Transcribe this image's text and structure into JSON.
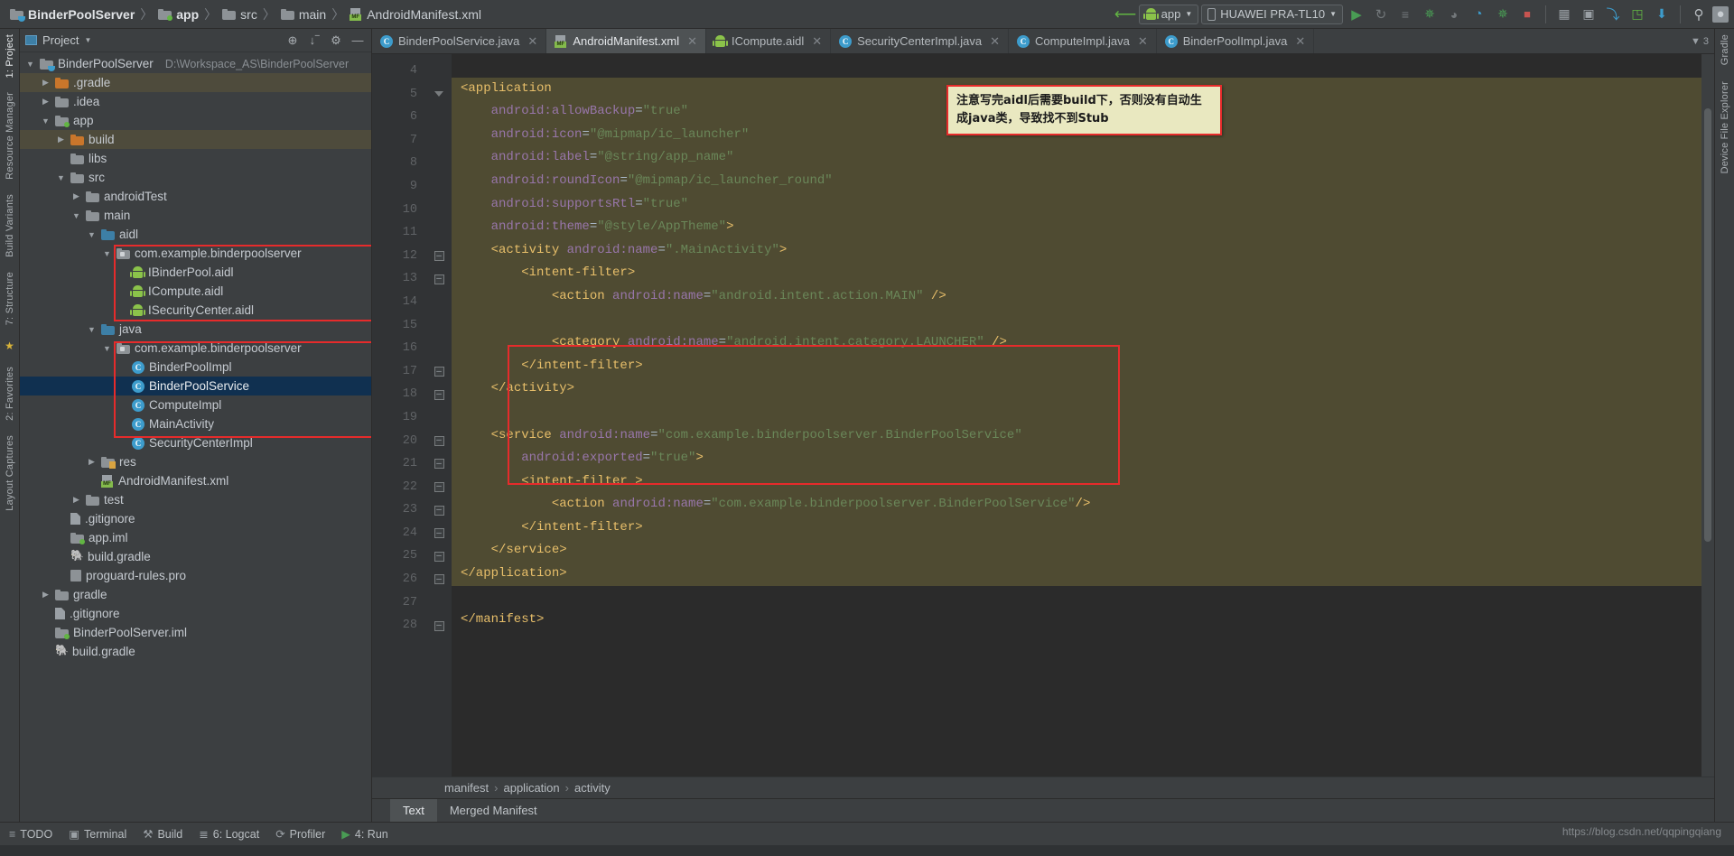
{
  "breadcrumb": {
    "items": [
      {
        "label": "BinderPoolServer",
        "icon": "project-folder-icon",
        "bold": true
      },
      {
        "label": "app",
        "icon": "module-folder-icon",
        "bold": true
      },
      {
        "label": "src",
        "icon": "folder-icon",
        "bold": false
      },
      {
        "label": "main",
        "icon": "folder-icon",
        "bold": false
      },
      {
        "label": "AndroidManifest.xml",
        "icon": "manifest-icon",
        "bold": false
      }
    ],
    "separator": "〉"
  },
  "toolbar": {
    "back_arrow": "↖",
    "run_config": "app",
    "device": "HUAWEI PRA-TL10",
    "dropdown_caret": "▼",
    "icons": [
      {
        "name": "run-icon",
        "glyph": "▶",
        "color": "#499c54"
      },
      {
        "name": "apply-changes-icon",
        "glyph": "↻",
        "color": "#6e7376"
      },
      {
        "name": "rerun-icon",
        "glyph": "≡",
        "color": "#6e7376"
      },
      {
        "name": "debug-icon",
        "glyph": "✵",
        "color": "#499c54"
      },
      {
        "name": "attach-debugger-icon",
        "glyph": "◗",
        "color": "#6e7376"
      },
      {
        "name": "profiler-icon",
        "glyph": "◔",
        "color": "#3d9ccc"
      },
      {
        "name": "run-with-coverage-icon",
        "glyph": "↗",
        "color": "#499c54"
      },
      {
        "name": "stop-icon",
        "glyph": "■",
        "color": "#c75450"
      },
      {
        "name": "sdk-manager-icon",
        "glyph": "▧",
        "color": "#9aa0a5"
      },
      {
        "name": "avd-manager-icon",
        "glyph": "▣",
        "color": "#9aa0a5"
      },
      {
        "name": "sync-gradle-icon",
        "glyph": "⤵",
        "color": "#3d9ccc"
      },
      {
        "name": "layout-inspector-icon",
        "glyph": "◳",
        "color": "#62b543"
      },
      {
        "name": "device-file-explorer-icon",
        "glyph": "⬇",
        "color": "#3d9ccc"
      },
      {
        "name": "search-everywhere-icon",
        "glyph": "⚲",
        "color": "#b8bdc1"
      },
      {
        "name": "user-avatar-icon",
        "glyph": "●",
        "color": "#c8cdd2"
      }
    ]
  },
  "left_strip": {
    "tabs": [
      {
        "label": "1: Project",
        "active": true
      },
      {
        "label": "Resource Manager",
        "active": false
      },
      {
        "label": "Build Variants",
        "active": false
      },
      {
        "label": "7: Structure",
        "active": false
      },
      {
        "label": "2: Favorites",
        "active": false
      },
      {
        "label": "Layout Captures",
        "active": false
      }
    ],
    "star_icon": "★"
  },
  "right_strip": {
    "tabs": [
      {
        "label": "Gradle"
      },
      {
        "label": "Device File Explorer"
      }
    ]
  },
  "project_panel": {
    "title": "Project",
    "caret": "▼",
    "header_icons": [
      {
        "name": "locate-icon",
        "glyph": "⊕"
      },
      {
        "name": "collapse-all-icon",
        "glyph": "⤓"
      },
      {
        "name": "settings-gear-icon",
        "glyph": "⚙"
      },
      {
        "name": "hide-icon",
        "glyph": "—"
      }
    ],
    "tree": [
      {
        "label": "BinderPoolServer",
        "sub": "D:\\Workspace_AS\\BinderPoolServer",
        "indent": 0,
        "twisty": "down",
        "icon": "project-folder-icon",
        "state": "normal"
      },
      {
        "label": ".gradle",
        "indent": 1,
        "twisty": "right",
        "icon": "folder-orange-icon",
        "state": "highlight"
      },
      {
        "label": ".idea",
        "indent": 1,
        "twisty": "right",
        "icon": "folder-icon",
        "state": "normal"
      },
      {
        "label": "app",
        "indent": 1,
        "twisty": "down",
        "icon": "module-folder-icon",
        "state": "normal"
      },
      {
        "label": "build",
        "indent": 2,
        "twisty": "right",
        "icon": "folder-orange-icon",
        "state": "highlight"
      },
      {
        "label": "libs",
        "indent": 2,
        "twisty": "none",
        "icon": "folder-icon",
        "state": "normal"
      },
      {
        "label": "src",
        "indent": 2,
        "twisty": "down",
        "icon": "folder-icon",
        "state": "normal"
      },
      {
        "label": "androidTest",
        "indent": 3,
        "twisty": "right",
        "icon": "folder-icon",
        "state": "normal"
      },
      {
        "label": "main",
        "indent": 3,
        "twisty": "down",
        "icon": "folder-icon",
        "state": "normal"
      },
      {
        "label": "aidl",
        "indent": 4,
        "twisty": "down",
        "icon": "folder-blue-icon",
        "state": "normal"
      },
      {
        "label": "com.example.binderpoolserver",
        "indent": 5,
        "twisty": "down",
        "icon": "package-icon",
        "state": "normal"
      },
      {
        "label": "IBinderPool.aidl",
        "indent": 6,
        "twisty": "none",
        "icon": "aidl-icon",
        "state": "normal"
      },
      {
        "label": "ICompute.aidl",
        "indent": 6,
        "twisty": "none",
        "icon": "aidl-icon",
        "state": "normal"
      },
      {
        "label": "ISecurityCenter.aidl",
        "indent": 6,
        "twisty": "none",
        "icon": "aidl-icon",
        "state": "normal"
      },
      {
        "label": "java",
        "indent": 4,
        "twisty": "down",
        "icon": "folder-blue-icon",
        "state": "normal"
      },
      {
        "label": "com.example.binderpoolserver",
        "indent": 5,
        "twisty": "down",
        "icon": "package-icon",
        "state": "normal"
      },
      {
        "label": "BinderPoolImpl",
        "indent": 6,
        "twisty": "none",
        "icon": "java-class-icon",
        "state": "normal"
      },
      {
        "label": "BinderPoolService",
        "indent": 6,
        "twisty": "none",
        "icon": "java-class-icon",
        "state": "selected"
      },
      {
        "label": "ComputeImpl",
        "indent": 6,
        "twisty": "none",
        "icon": "java-class-icon",
        "state": "normal"
      },
      {
        "label": "MainActivity",
        "indent": 6,
        "twisty": "none",
        "icon": "java-class-icon",
        "state": "normal"
      },
      {
        "label": "SecurityCenterImpl",
        "indent": 6,
        "twisty": "none",
        "icon": "java-class-icon",
        "state": "normal"
      },
      {
        "label": "res",
        "indent": 4,
        "twisty": "right",
        "icon": "res-folder-icon",
        "state": "normal"
      },
      {
        "label": "AndroidManifest.xml",
        "indent": 4,
        "twisty": "none",
        "icon": "manifest-icon",
        "state": "normal"
      },
      {
        "label": "test",
        "indent": 3,
        "twisty": "right",
        "icon": "folder-icon",
        "state": "normal"
      },
      {
        "label": ".gitignore",
        "indent": 2,
        "twisty": "none",
        "icon": "file-icon",
        "state": "normal"
      },
      {
        "label": "app.iml",
        "indent": 2,
        "twisty": "none",
        "icon": "module-folder-icon",
        "state": "normal"
      },
      {
        "label": "build.gradle",
        "indent": 2,
        "twisty": "none",
        "icon": "gradle-icon",
        "state": "normal"
      },
      {
        "label": "proguard-rules.pro",
        "indent": 2,
        "twisty": "none",
        "icon": "pro-file-icon",
        "state": "normal"
      },
      {
        "label": "gradle",
        "indent": 1,
        "twisty": "right",
        "icon": "folder-icon",
        "state": "normal"
      },
      {
        "label": ".gitignore",
        "indent": 1,
        "twisty": "none",
        "icon": "file-icon",
        "state": "normal"
      },
      {
        "label": "BinderPoolServer.iml",
        "indent": 1,
        "twisty": "none",
        "icon": "module-folder-icon",
        "state": "normal"
      },
      {
        "label": "build.gradle",
        "indent": 1,
        "twisty": "none",
        "icon": "gradle-icon",
        "state": "normal"
      }
    ]
  },
  "editor": {
    "tabs": [
      {
        "label": "BinderPoolService.java",
        "icon": "java-class-icon",
        "active": false,
        "close": "✕"
      },
      {
        "label": "AndroidManifest.xml",
        "icon": "manifest-icon",
        "active": true,
        "close": "✕"
      },
      {
        "label": "ICompute.aidl",
        "icon": "aidl-icon",
        "active": false,
        "close": "✕"
      },
      {
        "label": "SecurityCenterImpl.java",
        "icon": "java-class-icon",
        "active": false,
        "close": "✕"
      },
      {
        "label": "ComputeImpl.java",
        "icon": "java-class-icon",
        "active": false,
        "close": "✕"
      },
      {
        "label": "BinderPoolImpl.java",
        "icon": "java-class-icon",
        "active": false,
        "close": "✕"
      }
    ],
    "tabs_overflow": "▼ 3",
    "line_numbers": [
      4,
      5,
      6,
      7,
      8,
      9,
      10,
      11,
      12,
      13,
      14,
      15,
      16,
      17,
      18,
      19,
      20,
      21,
      22,
      23,
      24,
      25,
      26,
      27,
      28
    ],
    "code_lines": [
      {
        "n": 4,
        "segments": [],
        "shade": false
      },
      {
        "n": 5,
        "segments": [
          {
            "t": "<application",
            "c": "tag"
          }
        ],
        "shade": true
      },
      {
        "n": 6,
        "segments": [
          {
            "t": "    ",
            "c": "plain"
          },
          {
            "t": "android:allowBackup",
            "c": "attr"
          },
          {
            "t": "=",
            "c": "plain"
          },
          {
            "t": "\"true\"",
            "c": "val"
          }
        ],
        "shade": true
      },
      {
        "n": 7,
        "segments": [
          {
            "t": "    ",
            "c": "plain"
          },
          {
            "t": "android:icon",
            "c": "attr"
          },
          {
            "t": "=",
            "c": "plain"
          },
          {
            "t": "\"@mipmap/ic_launcher\"",
            "c": "val"
          }
        ],
        "shade": true
      },
      {
        "n": 8,
        "segments": [
          {
            "t": "    ",
            "c": "plain"
          },
          {
            "t": "android:label",
            "c": "attr"
          },
          {
            "t": "=",
            "c": "plain"
          },
          {
            "t": "\"@string/app_name\"",
            "c": "val"
          }
        ],
        "shade": true
      },
      {
        "n": 9,
        "segments": [
          {
            "t": "    ",
            "c": "plain"
          },
          {
            "t": "android:roundIcon",
            "c": "attr"
          },
          {
            "t": "=",
            "c": "plain"
          },
          {
            "t": "\"@mipmap/ic_launcher_round\"",
            "c": "val"
          }
        ],
        "shade": true
      },
      {
        "n": 10,
        "segments": [
          {
            "t": "    ",
            "c": "plain"
          },
          {
            "t": "android:supportsRtl",
            "c": "attr"
          },
          {
            "t": "=",
            "c": "plain"
          },
          {
            "t": "\"true\"",
            "c": "val"
          }
        ],
        "shade": true
      },
      {
        "n": 11,
        "segments": [
          {
            "t": "    ",
            "c": "plain"
          },
          {
            "t": "android:theme",
            "c": "attr"
          },
          {
            "t": "=",
            "c": "plain"
          },
          {
            "t": "\"@style/AppTheme\"",
            "c": "val"
          },
          {
            "t": ">",
            "c": "tag"
          }
        ],
        "shade": true
      },
      {
        "n": 12,
        "segments": [
          {
            "t": "    ",
            "c": "plain"
          },
          {
            "t": "<activity ",
            "c": "tag"
          },
          {
            "t": "android:name",
            "c": "attr"
          },
          {
            "t": "=",
            "c": "plain"
          },
          {
            "t": "\".MainActivity\"",
            "c": "val"
          },
          {
            "t": ">",
            "c": "tag"
          }
        ],
        "shade": true
      },
      {
        "n": 13,
        "segments": [
          {
            "t": "        ",
            "c": "plain"
          },
          {
            "t": "<intent-filter>",
            "c": "tag"
          }
        ],
        "shade": true
      },
      {
        "n": 14,
        "segments": [
          {
            "t": "            ",
            "c": "plain"
          },
          {
            "t": "<action ",
            "c": "tag"
          },
          {
            "t": "android:name",
            "c": "attr"
          },
          {
            "t": "=",
            "c": "plain"
          },
          {
            "t": "\"android.intent.action.MAIN\"",
            "c": "val"
          },
          {
            "t": " />",
            "c": "tag"
          }
        ],
        "shade": true
      },
      {
        "n": 15,
        "segments": [],
        "shade": true
      },
      {
        "n": 16,
        "segments": [
          {
            "t": "            ",
            "c": "plain"
          },
          {
            "t": "<category ",
            "c": "tag"
          },
          {
            "t": "android:name",
            "c": "attr"
          },
          {
            "t": "=",
            "c": "plain"
          },
          {
            "t": "\"android.intent.category.LAUNCHER\"",
            "c": "val"
          },
          {
            "t": " />",
            "c": "tag"
          }
        ],
        "shade": true
      },
      {
        "n": 17,
        "segments": [
          {
            "t": "        ",
            "c": "plain"
          },
          {
            "t": "</intent-filter>",
            "c": "tag"
          }
        ],
        "shade": true
      },
      {
        "n": 18,
        "segments": [
          {
            "t": "    ",
            "c": "plain"
          },
          {
            "t": "</activity>",
            "c": "tag"
          }
        ],
        "shade": true
      },
      {
        "n": 19,
        "segments": [],
        "shade": true
      },
      {
        "n": 20,
        "segments": [
          {
            "t": "    ",
            "c": "plain"
          },
          {
            "t": "<service ",
            "c": "tag"
          },
          {
            "t": "android:name",
            "c": "attr"
          },
          {
            "t": "=",
            "c": "plain"
          },
          {
            "t": "\"com.example.binderpoolserver.BinderPoolService\"",
            "c": "val"
          }
        ],
        "shade": true
      },
      {
        "n": 21,
        "segments": [
          {
            "t": "        ",
            "c": "plain"
          },
          {
            "t": "android:exported",
            "c": "attr"
          },
          {
            "t": "=",
            "c": "plain"
          },
          {
            "t": "\"true\"",
            "c": "val"
          },
          {
            "t": ">",
            "c": "tag"
          }
        ],
        "shade": true
      },
      {
        "n": 22,
        "segments": [
          {
            "t": "        ",
            "c": "plain"
          },
          {
            "t": "<intent-filter >",
            "c": "tag"
          }
        ],
        "shade": true
      },
      {
        "n": 23,
        "segments": [
          {
            "t": "            ",
            "c": "plain"
          },
          {
            "t": "<action ",
            "c": "tag"
          },
          {
            "t": "android:name",
            "c": "attr"
          },
          {
            "t": "=",
            "c": "plain"
          },
          {
            "t": "\"com.example.binderpoolserver.BinderPoolService\"",
            "c": "val"
          },
          {
            "t": "/>",
            "c": "tag"
          }
        ],
        "shade": true
      },
      {
        "n": 24,
        "segments": [
          {
            "t": "        ",
            "c": "plain"
          },
          {
            "t": "</intent-filter>",
            "c": "tag"
          }
        ],
        "shade": true
      },
      {
        "n": 25,
        "segments": [
          {
            "t": "    ",
            "c": "plain"
          },
          {
            "t": "</service>",
            "c": "tag"
          }
        ],
        "shade": true
      },
      {
        "n": 26,
        "segments": [
          {
            "t": "</application>",
            "c": "tag"
          }
        ],
        "shade": true
      },
      {
        "n": 27,
        "segments": [],
        "shade": false
      },
      {
        "n": 28,
        "segments": [
          {
            "t": "</manifest>",
            "c": "tag"
          }
        ],
        "shade": false
      }
    ],
    "note_tooltip": "注意写完aidl后需要build下，否则没有自动生成java类，导致找不到Stub",
    "crumb": [
      "manifest",
      "application",
      "activity"
    ],
    "crumb_sep": "›",
    "view_tabs": [
      {
        "label": "Text",
        "active": true
      },
      {
        "label": "Merged Manifest",
        "active": false
      }
    ]
  },
  "status_bar": {
    "items": [
      {
        "label": "TODO",
        "icon": "todo-icon",
        "glyph": "≡"
      },
      {
        "label": "Terminal",
        "icon": "terminal-icon",
        "glyph": "▣"
      },
      {
        "label": "Build",
        "icon": "build-icon",
        "glyph": "⚒"
      },
      {
        "label": "6: Logcat",
        "icon": "logcat-icon",
        "glyph": "≣"
      },
      {
        "label": "Profiler",
        "icon": "profiler-icon",
        "glyph": "⟳"
      },
      {
        "label": "4: Run",
        "icon": "run-icon",
        "glyph": "▶"
      }
    ],
    "watermark": "https://blog.csdn.net/qqpingqiang"
  },
  "colors": {
    "accent_green": "#62b543",
    "annotation_red": "#e62b2b",
    "selection_blue": "#103050",
    "tooltip_bg": "#e9e8c0",
    "code_bg": "#2b2b2b",
    "shade_bg": "#4f4b32",
    "tag": "#e8bf6a",
    "attr": "#9876aa",
    "value": "#6a8759"
  }
}
